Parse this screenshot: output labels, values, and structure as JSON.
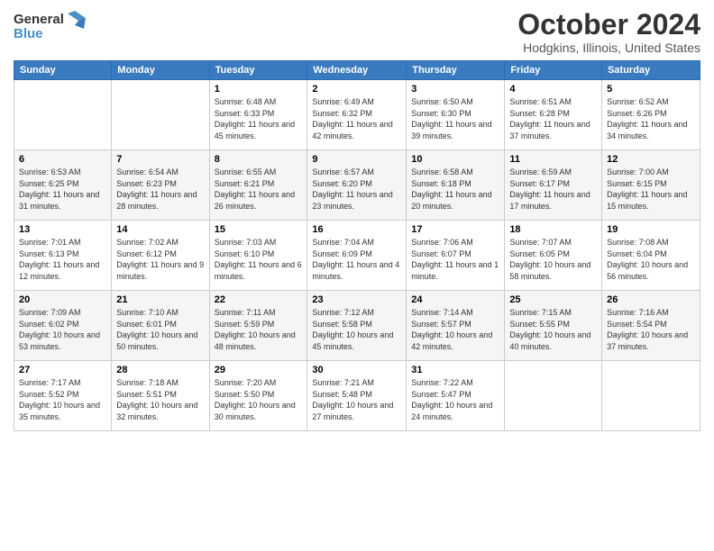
{
  "header": {
    "logo_general": "General",
    "logo_blue": "Blue",
    "month": "October 2024",
    "location": "Hodgkins, Illinois, United States"
  },
  "weekdays": [
    "Sunday",
    "Monday",
    "Tuesday",
    "Wednesday",
    "Thursday",
    "Friday",
    "Saturday"
  ],
  "weeks": [
    [
      {
        "day": "",
        "info": ""
      },
      {
        "day": "",
        "info": ""
      },
      {
        "day": "1",
        "info": "Sunrise: 6:48 AM\nSunset: 6:33 PM\nDaylight: 11 hours and 45 minutes."
      },
      {
        "day": "2",
        "info": "Sunrise: 6:49 AM\nSunset: 6:32 PM\nDaylight: 11 hours and 42 minutes."
      },
      {
        "day": "3",
        "info": "Sunrise: 6:50 AM\nSunset: 6:30 PM\nDaylight: 11 hours and 39 minutes."
      },
      {
        "day": "4",
        "info": "Sunrise: 6:51 AM\nSunset: 6:28 PM\nDaylight: 11 hours and 37 minutes."
      },
      {
        "day": "5",
        "info": "Sunrise: 6:52 AM\nSunset: 6:26 PM\nDaylight: 11 hours and 34 minutes."
      }
    ],
    [
      {
        "day": "6",
        "info": "Sunrise: 6:53 AM\nSunset: 6:25 PM\nDaylight: 11 hours and 31 minutes."
      },
      {
        "day": "7",
        "info": "Sunrise: 6:54 AM\nSunset: 6:23 PM\nDaylight: 11 hours and 28 minutes."
      },
      {
        "day": "8",
        "info": "Sunrise: 6:55 AM\nSunset: 6:21 PM\nDaylight: 11 hours and 26 minutes."
      },
      {
        "day": "9",
        "info": "Sunrise: 6:57 AM\nSunset: 6:20 PM\nDaylight: 11 hours and 23 minutes."
      },
      {
        "day": "10",
        "info": "Sunrise: 6:58 AM\nSunset: 6:18 PM\nDaylight: 11 hours and 20 minutes."
      },
      {
        "day": "11",
        "info": "Sunrise: 6:59 AM\nSunset: 6:17 PM\nDaylight: 11 hours and 17 minutes."
      },
      {
        "day": "12",
        "info": "Sunrise: 7:00 AM\nSunset: 6:15 PM\nDaylight: 11 hours and 15 minutes."
      }
    ],
    [
      {
        "day": "13",
        "info": "Sunrise: 7:01 AM\nSunset: 6:13 PM\nDaylight: 11 hours and 12 minutes."
      },
      {
        "day": "14",
        "info": "Sunrise: 7:02 AM\nSunset: 6:12 PM\nDaylight: 11 hours and 9 minutes."
      },
      {
        "day": "15",
        "info": "Sunrise: 7:03 AM\nSunset: 6:10 PM\nDaylight: 11 hours and 6 minutes."
      },
      {
        "day": "16",
        "info": "Sunrise: 7:04 AM\nSunset: 6:09 PM\nDaylight: 11 hours and 4 minutes."
      },
      {
        "day": "17",
        "info": "Sunrise: 7:06 AM\nSunset: 6:07 PM\nDaylight: 11 hours and 1 minute."
      },
      {
        "day": "18",
        "info": "Sunrise: 7:07 AM\nSunset: 6:05 PM\nDaylight: 10 hours and 58 minutes."
      },
      {
        "day": "19",
        "info": "Sunrise: 7:08 AM\nSunset: 6:04 PM\nDaylight: 10 hours and 56 minutes."
      }
    ],
    [
      {
        "day": "20",
        "info": "Sunrise: 7:09 AM\nSunset: 6:02 PM\nDaylight: 10 hours and 53 minutes."
      },
      {
        "day": "21",
        "info": "Sunrise: 7:10 AM\nSunset: 6:01 PM\nDaylight: 10 hours and 50 minutes."
      },
      {
        "day": "22",
        "info": "Sunrise: 7:11 AM\nSunset: 5:59 PM\nDaylight: 10 hours and 48 minutes."
      },
      {
        "day": "23",
        "info": "Sunrise: 7:12 AM\nSunset: 5:58 PM\nDaylight: 10 hours and 45 minutes."
      },
      {
        "day": "24",
        "info": "Sunrise: 7:14 AM\nSunset: 5:57 PM\nDaylight: 10 hours and 42 minutes."
      },
      {
        "day": "25",
        "info": "Sunrise: 7:15 AM\nSunset: 5:55 PM\nDaylight: 10 hours and 40 minutes."
      },
      {
        "day": "26",
        "info": "Sunrise: 7:16 AM\nSunset: 5:54 PM\nDaylight: 10 hours and 37 minutes."
      }
    ],
    [
      {
        "day": "27",
        "info": "Sunrise: 7:17 AM\nSunset: 5:52 PM\nDaylight: 10 hours and 35 minutes."
      },
      {
        "day": "28",
        "info": "Sunrise: 7:18 AM\nSunset: 5:51 PM\nDaylight: 10 hours and 32 minutes."
      },
      {
        "day": "29",
        "info": "Sunrise: 7:20 AM\nSunset: 5:50 PM\nDaylight: 10 hours and 30 minutes."
      },
      {
        "day": "30",
        "info": "Sunrise: 7:21 AM\nSunset: 5:48 PM\nDaylight: 10 hours and 27 minutes."
      },
      {
        "day": "31",
        "info": "Sunrise: 7:22 AM\nSunset: 5:47 PM\nDaylight: 10 hours and 24 minutes."
      },
      {
        "day": "",
        "info": ""
      },
      {
        "day": "",
        "info": ""
      }
    ]
  ]
}
